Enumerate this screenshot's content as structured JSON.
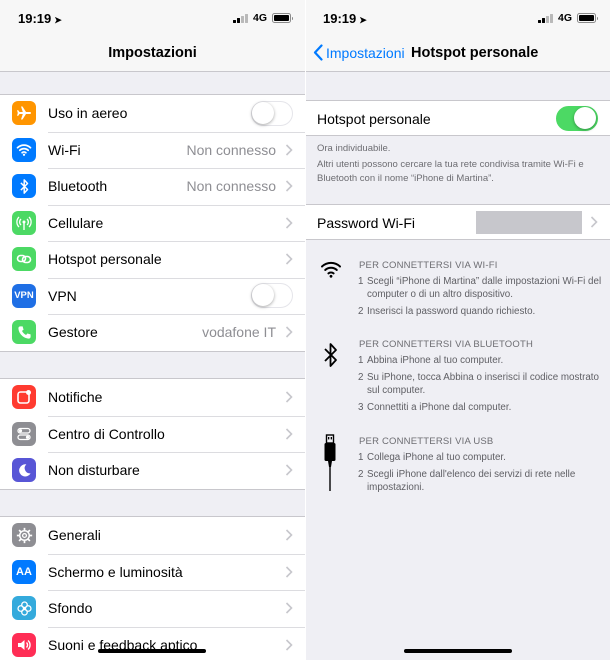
{
  "left": {
    "status": {
      "time": "19:19",
      "network": "4G"
    },
    "nav_title": "Impostazioni",
    "groups": [
      [
        {
          "label": "Uso in aereo",
          "icon": "airplane-icon",
          "color": "#ff9500",
          "type": "toggle",
          "on": false
        },
        {
          "label": "Wi-Fi",
          "icon": "wifi-icon",
          "color": "#007aff",
          "type": "chevron",
          "value": "Non connesso"
        },
        {
          "label": "Bluetooth",
          "icon": "bluetooth-icon",
          "color": "#007aff",
          "type": "chevron",
          "value": "Non connesso"
        },
        {
          "label": "Cellulare",
          "icon": "antenna-icon",
          "color": "#4cd964",
          "type": "chevron",
          "value": ""
        },
        {
          "label": "Hotspot personale",
          "icon": "hotspot-icon",
          "color": "#4cd964",
          "type": "chevron",
          "value": ""
        },
        {
          "label": "VPN",
          "icon": "vpn-icon",
          "color": "#1f6fe5",
          "type": "toggle",
          "on": false,
          "icon_text": "VPN"
        },
        {
          "label": "Gestore",
          "icon": "phone-icon",
          "color": "#4cd964",
          "type": "chevron",
          "value": "vodafone IT"
        }
      ],
      [
        {
          "label": "Notifiche",
          "icon": "notifications-icon",
          "color": "#ff3b30",
          "type": "chevron",
          "value": ""
        },
        {
          "label": "Centro di Controllo",
          "icon": "control-center-icon",
          "color": "#8e8e93",
          "type": "chevron",
          "value": ""
        },
        {
          "label": "Non disturbare",
          "icon": "moon-icon",
          "color": "#5856d6",
          "type": "chevron",
          "value": ""
        }
      ],
      [
        {
          "label": "Generali",
          "icon": "gear-icon",
          "color": "#8e8e93",
          "type": "chevron",
          "value": ""
        },
        {
          "label": "Schermo e luminosità",
          "icon": "display-icon",
          "color": "#007aff",
          "type": "chevron",
          "value": "",
          "icon_text": "AA"
        },
        {
          "label": "Sfondo",
          "icon": "wallpaper-icon",
          "color": "#34aadc",
          "type": "chevron",
          "value": ""
        },
        {
          "label": "Suoni e feedback aptico",
          "icon": "speaker-icon",
          "color": "#ff2d55",
          "type": "chevron",
          "value": ""
        }
      ]
    ]
  },
  "right": {
    "status": {
      "time": "19:19",
      "network": "4G"
    },
    "back_label": "Impostazioni",
    "nav_title": "Hotspot personale",
    "hotspot_label": "Hotspot personale",
    "hotspot_on": true,
    "footnote_line1": "Ora individuabile.",
    "footnote_line2": "Altri utenti possono cercare la tua rete condivisa tramite Wi-Fi e Bluetooth con il nome “iPhone di Martina”.",
    "password_label": "Password Wi-Fi",
    "sections": [
      {
        "icon": "wifi-icon",
        "heading": "PER CONNETTERSI VIA WI-FI",
        "steps": [
          {
            "num": "1",
            "text": "Scegli “iPhone di Martina” dalle impostazioni Wi-Fi del computer o di un altro dispositivo."
          },
          {
            "num": "2",
            "text": "Inserisci la password quando richiesto."
          }
        ]
      },
      {
        "icon": "bluetooth-icon",
        "heading": "PER CONNETTERSI VIA BLUETOOTH",
        "steps": [
          {
            "num": "1",
            "text": "Abbina iPhone al tuo computer."
          },
          {
            "num": "2",
            "text": "Su iPhone, tocca Abbina o inserisci il codice mostrato sul computer."
          },
          {
            "num": "3",
            "text": "Connettiti a iPhone dal computer."
          }
        ]
      },
      {
        "icon": "usb-icon",
        "heading": "PER CONNETTERSI VIA USB",
        "steps": [
          {
            "num": "1",
            "text": "Collega iPhone al tuo computer."
          },
          {
            "num": "2",
            "text": "Scegli iPhone dall'elenco dei servizi di rete nelle impostazioni."
          }
        ]
      }
    ]
  },
  "colors": {
    "accent": "#007aff",
    "switch_on": "#4cd964",
    "background": "#efeff4"
  }
}
